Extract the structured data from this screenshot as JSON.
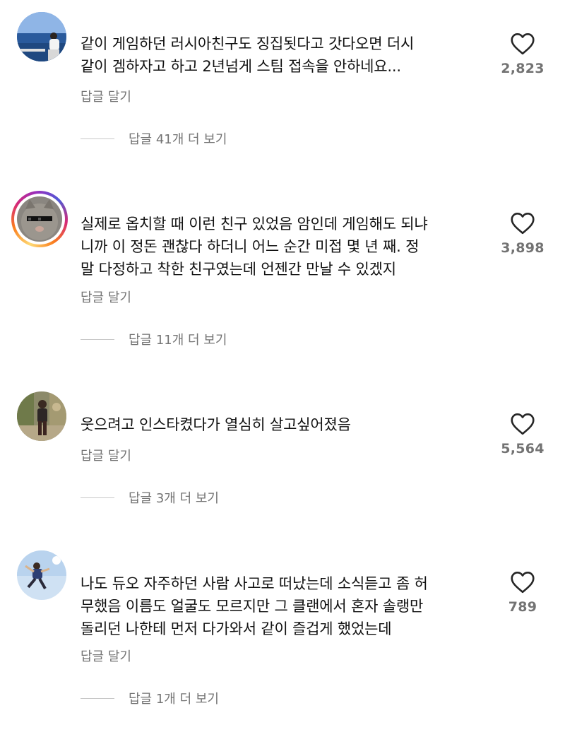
{
  "comments": [
    {
      "lines": [
        "같이 게임하던 러시아친구도 징집됫다고 갓다오면 더시",
        "같이 겜하자고 하고 2년넘게 스팀 접속을 안하네요..."
      ],
      "reply_label": "답글 달기",
      "view_replies": "답글 41개 더 보기",
      "likes": "2,823",
      "avatar_icon": "profile-photo-ocean-person"
    },
    {
      "lines": [
        "실제로 옵치할 때 이런 친구 있었음 암인데 게임해도 되냐",
        "니까 이 정돈 괜찮다 하더니 어느 순간 미접 몇 년 째. 정",
        "말 다정하고 착한 친구였는데 언젠간 만날 수 있겠지"
      ],
      "reply_label": "답글 달기",
      "view_replies": "답글 11개 더 보기",
      "likes": "3,898",
      "avatar_icon": "profile-photo-cat-sunglasses"
    },
    {
      "lines": [
        "웃으려고 인스타켰다가 열심히 살고싶어졌음"
      ],
      "reply_label": "답글 달기",
      "view_replies": "답글 3개 더 보기",
      "likes": "5,564",
      "avatar_icon": "profile-photo-person-garden"
    },
    {
      "lines": [
        "나도 듀오 자주하던 사람 사고로 떠났는데 소식듣고 좀 허",
        "무했음 이름도 얼굴도 모르지만 그 클랜에서 혼자 솔랭만",
        "돌리던 나한테 먼저 다가와서 같이 즐겁게 했었는데"
      ],
      "reply_label": "답글 달기",
      "view_replies": "답글 1개 더 보기",
      "likes": "789",
      "avatar_icon": "profile-photo-person-jumping"
    }
  ],
  "colors": {
    "text": "#111111",
    "secondary": "#737373",
    "divider": "#c7c7c7",
    "heart_outline": "#262626"
  },
  "icons": {
    "like": "heart-outline-icon"
  }
}
